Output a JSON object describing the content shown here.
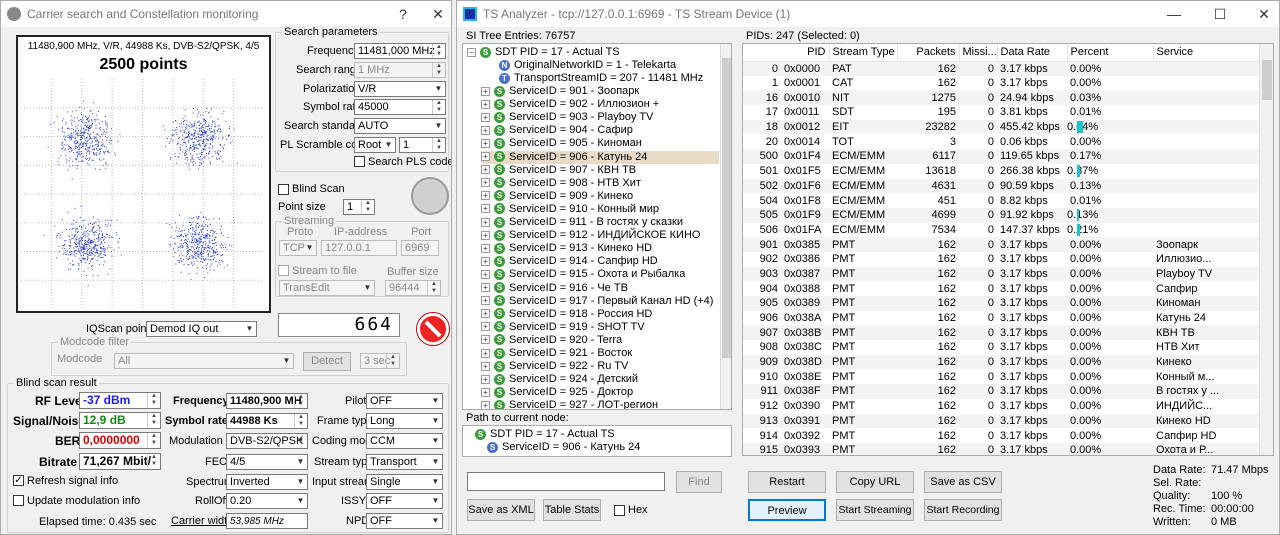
{
  "carrier": {
    "title": "Carrier search and Constellation monitoring",
    "close": "✕",
    "help": "?",
    "const": {
      "info": "11480,900 MHz, V/R, 44988 Ks, DVB-S2/QPSK, 4/5",
      "points": "2500 points"
    },
    "search": {
      "group": "Search parameters",
      "freq_label": "Frequency",
      "freq": "11481,000 MHz",
      "range_label": "Search range",
      "range": "1 MHz",
      "pol_label": "Polarization",
      "pol": "V/R",
      "sr_label": "Symbol rate",
      "sr": "45000",
      "std_label": "Search standard",
      "std": "AUTO",
      "pls_label": "PL Scramble code",
      "pls_mode": "Root",
      "pls_val": "1",
      "pls_search": "Search PLS code"
    },
    "blind_scan": "Blind Scan",
    "point_size_label": "Point size",
    "point_size": "1",
    "streaming": {
      "group": "Streaming",
      "proto_h": "Proto",
      "ip_h": "IP-address",
      "port_h": "Port",
      "proto": "TCP",
      "ip": "127.0.0.1",
      "port": "6969",
      "to_file": "Stream to file",
      "buf_h": "Buffer size",
      "file": "TransEdit",
      "buf": "96444"
    },
    "lcd": "664",
    "iq_label": "IQScan point",
    "iq": "Demod IQ out",
    "modcode": {
      "group": "Modcode filter",
      "label": "Modcode",
      "value": "All",
      "detect": "Detect",
      "sec": "3 sec"
    },
    "blind": {
      "group": "Blind scan result",
      "rf_label": "RF Level",
      "rf": "-37 dBm",
      "sn_label": "Signal/Noise",
      "sn": "12,9 dB",
      "ber_label": "BER",
      "ber": "0,0000000",
      "br_label": "Bitrate",
      "br": "71,267 Mbit/",
      "f_label": "Frequency",
      "f": "11480,900 MH",
      "sr_label": "Symbol rate",
      "sr": "44988 Ks",
      "mod_label": "Modulation",
      "mod": "DVB-S2/QPSK",
      "fec_label": "FEC",
      "fec": "4/5",
      "spec_label": "Spectrum",
      "spec": "Inverted",
      "ro_label": "RollOff",
      "ro": "0.20",
      "cw_label": "Carrier width",
      "cw": "53,985 MHz",
      "pilot_label": "Pilot",
      "pilot": "OFF",
      "ft_label": "Frame type",
      "ft": "Long",
      "cm_label": "Coding mode",
      "cm": "CCM",
      "st_label": "Stream type",
      "st": "Transport",
      "is_label": "Input stream",
      "is": "Single",
      "issyi_label": "ISSYI",
      "issyi": "OFF",
      "npd_label": "NPD",
      "npd": "OFF",
      "refresh": "Refresh signal info",
      "update": "Update modulation info",
      "elapsed": "Elapsed time: 0.435 sec"
    }
  },
  "ts": {
    "title": "TS Analyzer - tcp://127.0.0.1:6969 - TS Stream Device (1)",
    "min": "—",
    "max": "☐",
    "close": "✕",
    "si_header": "SI Tree Entries: 76757",
    "pids_header": "PIDs: 247  (Selected: 0)",
    "tree_root": "SDT PID = 17 - Actual TS",
    "tree_info": [
      "OriginalNetworkID = 1 - Telekarta",
      "TransportStreamID = 207 - 11481 MHz"
    ],
    "services": [
      "ServiceID = 901 - Зоопарк",
      "ServiceID = 902 - Иллюзион +",
      "ServiceID = 903 - Playboy TV",
      "ServiceID = 904 - Сафир",
      "ServiceID = 905 - Киноман",
      "ServiceID = 906 - Катунь 24",
      "ServiceID = 907 - КВН ТВ",
      "ServiceID = 908 - НТВ Хит",
      "ServiceID = 909 - Кинеко",
      "ServiceID = 910 - Конный мир",
      "ServiceID = 911 - В гостях у сказки",
      "ServiceID = 912 - ИНДИЙСКОЕ КИНО",
      "ServiceID = 913 - Кинеко HD",
      "ServiceID = 914 - Сапфир HD",
      "ServiceID = 915 - Охота и Рыбалка",
      "ServiceID = 916 - Че ТВ",
      "ServiceID = 917 - Первый Канал HD (+4)",
      "ServiceID = 918 - Россия HD",
      "ServiceID = 919 - SHOT TV",
      "ServiceID = 920 - Terra",
      "ServiceID = 921 - Восток",
      "ServiceID = 922 - Ru TV",
      "ServiceID = 924 - Детский",
      "ServiceID = 925 - Доктор",
      "ServiceID = 927 - ЛОТ-регион"
    ],
    "selected_index": 5,
    "path_label": "Path to current node:",
    "path": [
      "SDT PID = 17 - Actual TS",
      "ServiceID = 906 - Катунь 24"
    ],
    "find": "Find",
    "save_xml": "Save as XML",
    "table_stats": "Table Stats",
    "hex": "Hex",
    "columns": [
      "PID",
      "Stream Type",
      "Packets",
      "Missi...",
      "Data Rate",
      "Percent",
      "Service"
    ],
    "rows": [
      [
        "0",
        "0x0000",
        "PAT",
        "162",
        "0",
        "3.17 kbps",
        "0.00%",
        ""
      ],
      [
        "1",
        "0x0001",
        "CAT",
        "162",
        "0",
        "3.17 kbps",
        "0.00%",
        ""
      ],
      [
        "16",
        "0x0010",
        "NIT",
        "1275",
        "0",
        "24.94 kbps",
        "0.03%",
        ""
      ],
      [
        "17",
        "0x0011",
        "SDT",
        "195",
        "0",
        "3.81 kbps",
        "0.01%",
        ""
      ],
      [
        "18",
        "0x0012",
        "EIT",
        "23282",
        "0",
        "455.42 kbps",
        "0.64%",
        ""
      ],
      [
        "20",
        "0x0014",
        "TOT",
        "3",
        "0",
        "0.06 kbps",
        "0.00%",
        ""
      ],
      [
        "500",
        "0x01F4",
        "ECM/EMM",
        "6117",
        "0",
        "119.65 kbps",
        "0.17%",
        ""
      ],
      [
        "501",
        "0x01F5",
        "ECM/EMM",
        "13618",
        "0",
        "266.38 kbps",
        "0.37%",
        ""
      ],
      [
        "502",
        "0x01F6",
        "ECM/EMM",
        "4631",
        "0",
        "90.59 kbps",
        "0.13%",
        ""
      ],
      [
        "504",
        "0x01F8",
        "ECM/EMM",
        "451",
        "0",
        "8.82 kbps",
        "0.01%",
        ""
      ],
      [
        "505",
        "0x01F9",
        "ECM/EMM",
        "4699",
        "0",
        "91.92 kbps",
        "0.13%",
        ""
      ],
      [
        "506",
        "0x01FA",
        "ECM/EMM",
        "7534",
        "0",
        "147.37 kbps",
        "0.21%",
        ""
      ],
      [
        "901",
        "0x0385",
        "PMT",
        "162",
        "0",
        "3.17 kbps",
        "0.00%",
        "Зоопарк"
      ],
      [
        "902",
        "0x0386",
        "PMT",
        "162",
        "0",
        "3.17 kbps",
        "0.00%",
        "Иллюзио..."
      ],
      [
        "903",
        "0x0387",
        "PMT",
        "162",
        "0",
        "3.17 kbps",
        "0.00%",
        "Playboy TV"
      ],
      [
        "904",
        "0x0388",
        "PMT",
        "162",
        "0",
        "3.17 kbps",
        "0.00%",
        "Сапфир"
      ],
      [
        "905",
        "0x0389",
        "PMT",
        "162",
        "0",
        "3.17 kbps",
        "0.00%",
        "Киноман"
      ],
      [
        "906",
        "0x038A",
        "PMT",
        "162",
        "0",
        "3.17 kbps",
        "0.00%",
        "Катунь 24"
      ],
      [
        "907",
        "0x038B",
        "PMT",
        "162",
        "0",
        "3.17 kbps",
        "0.00%",
        "КВН ТВ"
      ],
      [
        "908",
        "0x038C",
        "PMT",
        "162",
        "0",
        "3.17 kbps",
        "0.00%",
        "НТВ Хит"
      ],
      [
        "909",
        "0x038D",
        "PMT",
        "162",
        "0",
        "3.17 kbps",
        "0.00%",
        "Кинеко"
      ],
      [
        "910",
        "0x038E",
        "PMT",
        "162",
        "0",
        "3.17 kbps",
        "0.00%",
        "Конный м..."
      ],
      [
        "911",
        "0x038F",
        "PMT",
        "162",
        "0",
        "3.17 kbps",
        "0.00%",
        "В гостях у ..."
      ],
      [
        "912",
        "0x0390",
        "PMT",
        "162",
        "0",
        "3.17 kbps",
        "0.00%",
        "ИНДИЙС..."
      ],
      [
        "913",
        "0x0391",
        "PMT",
        "162",
        "0",
        "3.17 kbps",
        "0.00%",
        "Кинеко HD"
      ],
      [
        "914",
        "0x0392",
        "PMT",
        "162",
        "0",
        "3.17 kbps",
        "0.00%",
        "Сапфир HD"
      ],
      [
        "915",
        "0x0393",
        "PMT",
        "162",
        "0",
        "3.17 kbps",
        "0.00%",
        "Охота и Р..."
      ]
    ],
    "bar_fractions": [
      0,
      0,
      0,
      0,
      0.6,
      0,
      0,
      0.3,
      0,
      0,
      0.2,
      0.25,
      0,
      0,
      0,
      0,
      0,
      0,
      0,
      0,
      0,
      0,
      0,
      0,
      0,
      0,
      0
    ],
    "buttons": {
      "restart": "Restart",
      "copy_url": "Copy URL",
      "save_csv": "Save as CSV",
      "preview": "Preview",
      "start_streaming": "Start Streaming",
      "start_recording": "Start Recording"
    },
    "stats": {
      "dr_label": "Data Rate:",
      "dr": "71.47 Mbps",
      "sr_label": "Sel. Rate:",
      "sr": "",
      "q_label": "Quality:",
      "q": "100 %",
      "rt_label": "Rec. Time:",
      "rt": "00:00:00",
      "wr_label": "Written:",
      "wr": "0 MB"
    }
  },
  "colors": {
    "accent": "#0078d7",
    "selected_row": "#e8dcc8",
    "rf_text": "#1a1aff",
    "sn_text": "#118811",
    "ber_text": "#e00000",
    "bar": "#19c6d0",
    "scatter": "#2a3ccf"
  }
}
